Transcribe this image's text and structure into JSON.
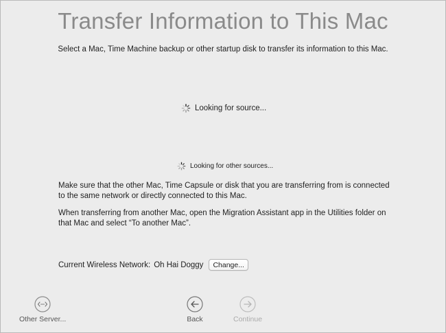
{
  "header": {
    "title": "Transfer Information to This Mac",
    "subtitle": "Select a Mac, Time Machine backup or other startup disk to transfer its information to this Mac."
  },
  "status": {
    "source": "Looking for source...",
    "other_sources": "Looking for other sources..."
  },
  "instructions": {
    "p1": "Make sure that the other Mac, Time Capsule or disk that you are transferring from is connected to the same network or directly connected to this Mac.",
    "p2": "When transferring from another Mac, open the Migration Assistant app in the Utilities folder on that Mac and select “To another Mac”."
  },
  "network": {
    "label": "Current Wireless Network:",
    "name": "Oh Hai Doggy",
    "change_label": "Change..."
  },
  "footer": {
    "other_server": "Other Server...",
    "back": "Back",
    "continue": "Continue"
  },
  "icons": {
    "spinner": "spinner-icon",
    "other_server": "network-server-icon",
    "back": "arrow-left-circle-icon",
    "continue": "arrow-right-circle-icon"
  },
  "colors": {
    "background": "#ececec",
    "title": "#8a8a8a",
    "disabled": "#aaaaaa"
  }
}
